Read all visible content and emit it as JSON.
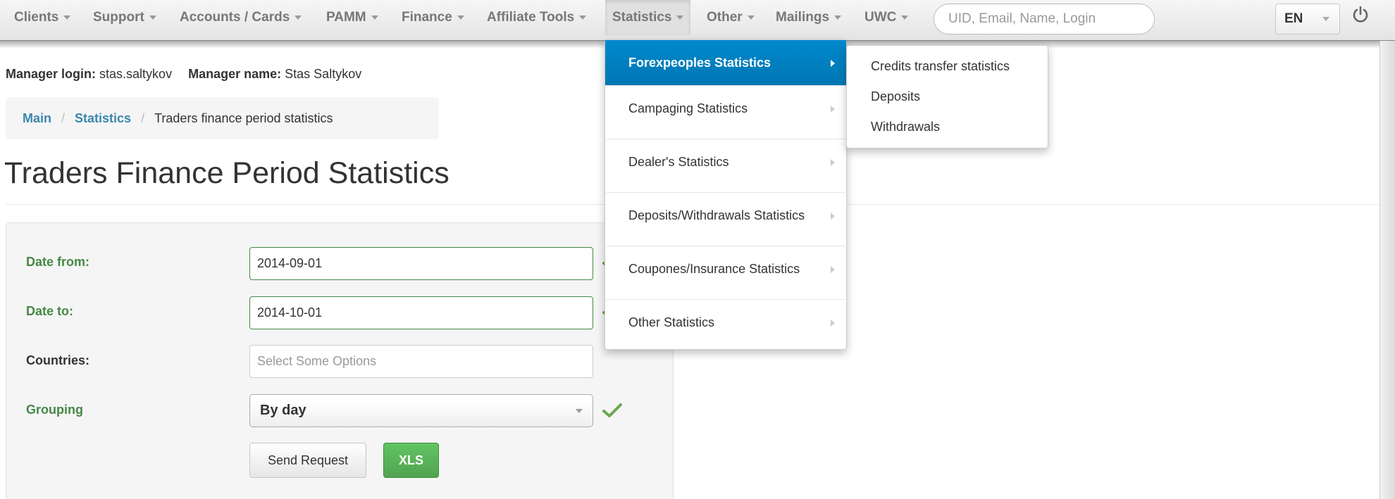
{
  "nav": {
    "items": [
      {
        "label": "Clients"
      },
      {
        "label": "Support"
      },
      {
        "label": "Accounts / Cards"
      },
      {
        "label": "PAMM"
      },
      {
        "label": "Finance"
      },
      {
        "label": "Affiliate Tools"
      },
      {
        "label": "Statistics"
      },
      {
        "label": "Other"
      },
      {
        "label": "Mailings"
      },
      {
        "label": "UWC"
      }
    ],
    "search_placeholder": "UID, Email, Name, Login",
    "language": "EN",
    "power_icon": "power-icon"
  },
  "manager": {
    "login_label": "Manager login:",
    "login_value": "stas.saltykov",
    "name_label": "Manager name:",
    "name_value": "Stas Saltykov"
  },
  "breadcrumb": {
    "items": [
      "Main",
      "Statistics"
    ],
    "separator": "/",
    "current": "Traders finance period statistics"
  },
  "page_title": "Traders Finance Period Statistics",
  "form": {
    "date_from_label": "Date from:",
    "date_from_value": "2014-09-01",
    "date_to_label": "Date to:",
    "date_to_value": "2014-10-01",
    "countries_label": "Countries:",
    "countries_placeholder": "Select Some Options",
    "grouping_label": "Grouping",
    "grouping_value": "By day",
    "send_button": "Send Request",
    "xls_button": "XLS"
  },
  "statistics_menu": {
    "items": [
      {
        "label": "Forexpeoples Statistics"
      },
      {
        "label": "Campaging Statistics"
      },
      {
        "label": "Dealer's Statistics"
      },
      {
        "label": "Deposits/Withdrawals Statistics"
      },
      {
        "label": "Coupones/Insurance Statistics"
      },
      {
        "label": "Other Statistics"
      }
    ],
    "submenu": [
      {
        "label": "Credits transfer statistics"
      },
      {
        "label": "Deposits"
      },
      {
        "label": "Withdrawals"
      }
    ]
  },
  "colors": {
    "link": "#3a87ad",
    "success_label": "#468847",
    "menu_active": "#0088cc",
    "xls_button": "#5bb75b"
  }
}
